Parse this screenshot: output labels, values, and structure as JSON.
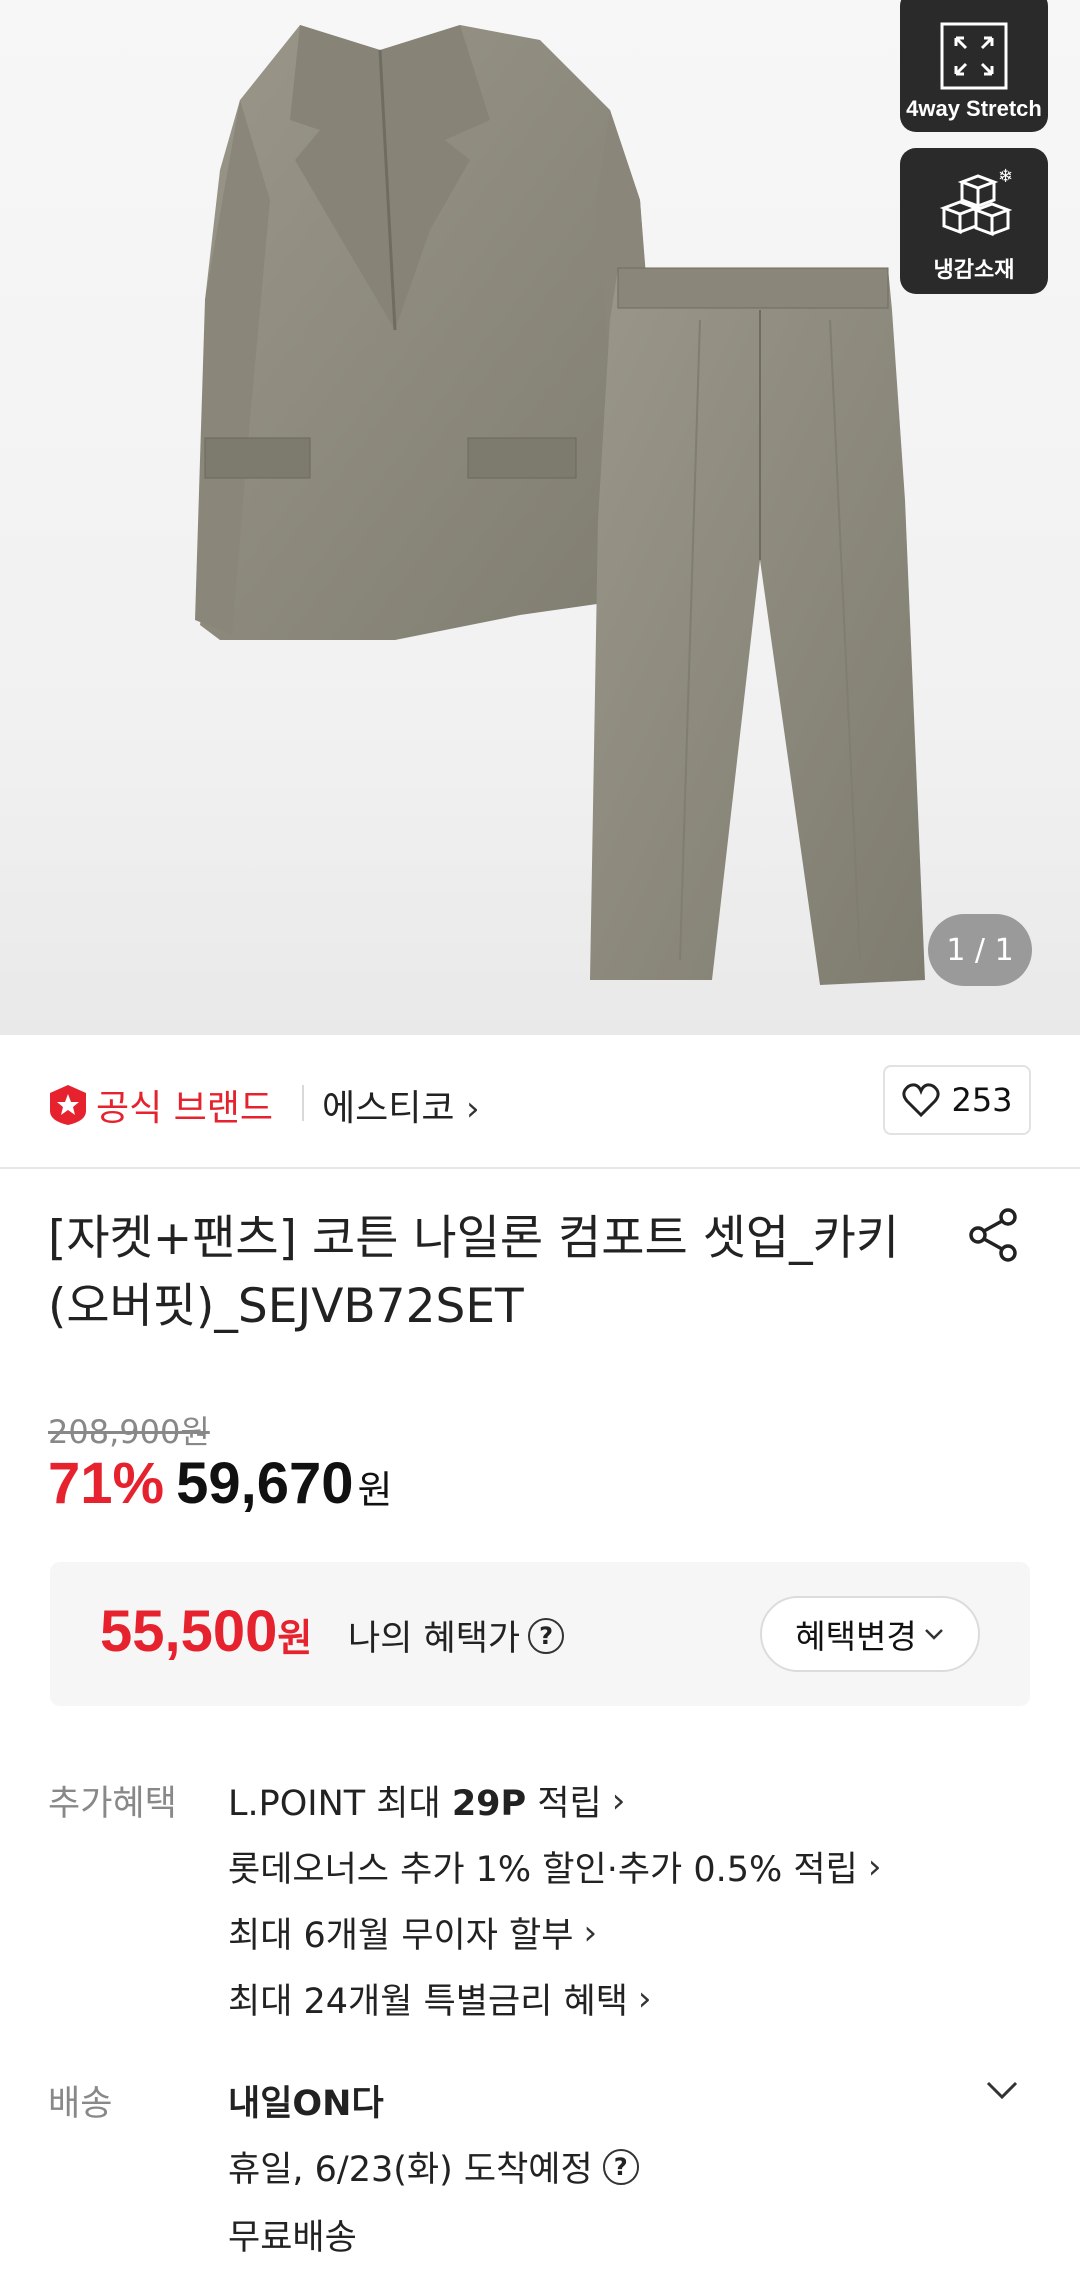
{
  "hero": {
    "badges": [
      {
        "label": "4way Stretch",
        "icon": "stretch-arrows-icon"
      },
      {
        "label": "냉감소재",
        "icon": "ice-cubes-icon"
      }
    ],
    "pager": "1 / 1"
  },
  "brand": {
    "official_label": "공식 브랜드",
    "name": "에스티코",
    "likes": "253"
  },
  "product": {
    "title_line1": "[자켓+팬츠] 코튼 나일론 컴포트 셋업_카키",
    "title_line2": "(오버핏)_SEJVB72SET"
  },
  "price": {
    "original": "208,900원",
    "discount": "71%",
    "sale": "59,670",
    "unit": "원"
  },
  "benefit": {
    "price": "55,500",
    "unit": "원",
    "label": "나의 혜택가",
    "help": "?",
    "change_button": "혜택변경"
  },
  "extra_benefits": {
    "label": "추가혜택",
    "items": [
      {
        "pre": "L.POINT 최대 ",
        "bold": "29P",
        "post": " 적립"
      },
      {
        "pre": "롯데오너스 추가 1% 할인·추가 0.5% 적립",
        "bold": "",
        "post": ""
      },
      {
        "pre": "최대 6개월 무이자 할부",
        "bold": "",
        "post": ""
      },
      {
        "pre": "최대 24개월 특별금리 혜택",
        "bold": "",
        "post": ""
      }
    ]
  },
  "delivery": {
    "label": "배송",
    "service": "내일ON다",
    "eta": "휴일, 6/23(화) 도착예정",
    "fee": "무료배송"
  },
  "colors": {
    "accent_red": "#e5222d",
    "khaki": "#8d8a7c"
  }
}
